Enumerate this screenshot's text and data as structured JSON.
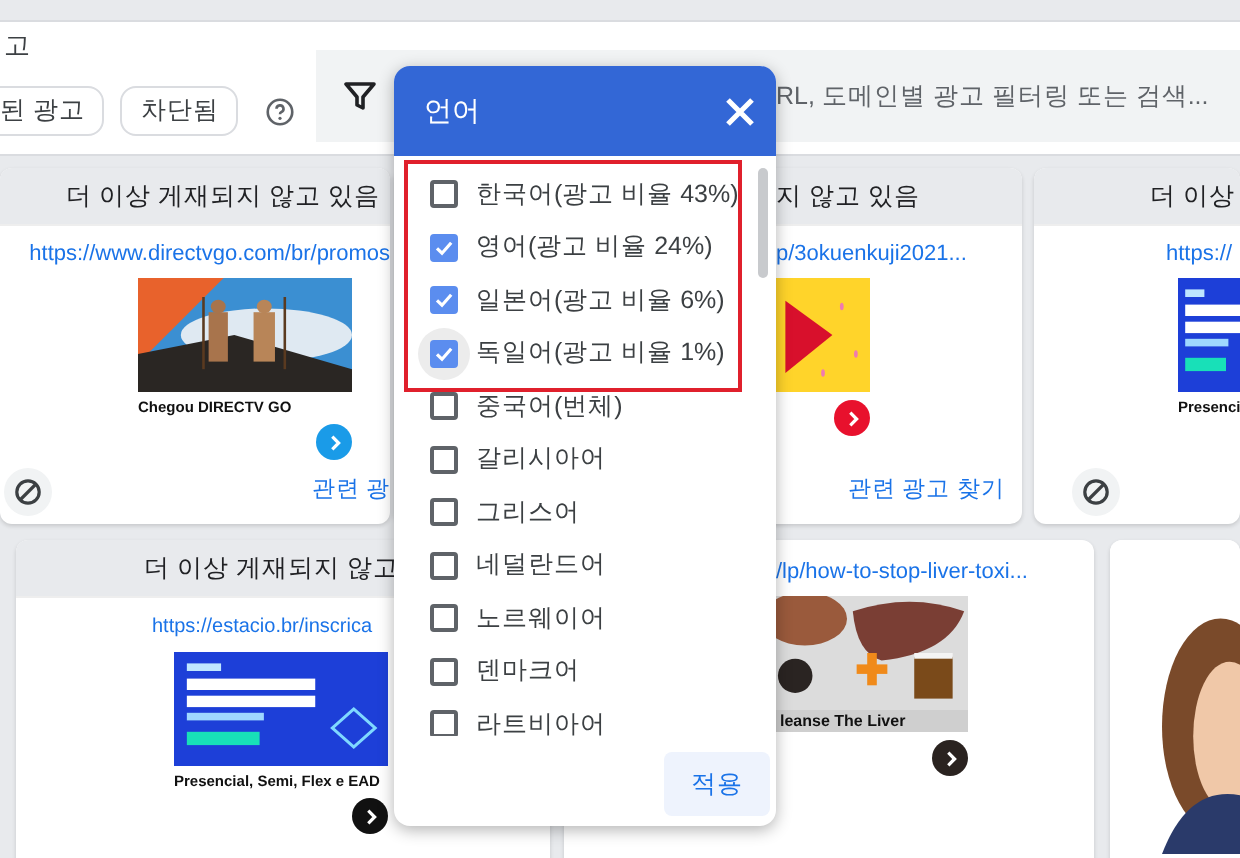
{
  "top": {
    "section_label": "고",
    "filter_buttons": [
      {
        "label": "된 광고"
      },
      {
        "label": "차단됨"
      }
    ],
    "search": {
      "placeholder": "RL, 도메인별 광고 필터링 또는 검색..."
    }
  },
  "cards": [
    {
      "header": "더 이상 게재되지 않고 있음",
      "link": "https://www.directvgo.com/br/promos",
      "ad": {
        "kind": "picture",
        "headline": "Chegou DIRECTV GO",
        "color": "#1a9be8"
      },
      "block_icon": true,
      "related": "관련 광"
    },
    {
      "header": "지 않고 있음",
      "link": "p/3okuenkuji2021...",
      "ad": {
        "kind": "picture",
        "color": "#e8112d"
      },
      "related": "관련 광고 찾기"
    },
    {
      "header": "더 이상",
      "link": "https://",
      "ad": {
        "kind": "picture",
        "headline": "Presenci"
      },
      "block_icon": true
    },
    {
      "header": "더 이상 게재되지 않고",
      "link": "https://estacio.br/inscrica",
      "ad": {
        "kind": "picture",
        "headline": "Presencial, Semi, Flex e EAD",
        "color": "#111111"
      }
    },
    {
      "link": "/lp/how-to-stop-liver-toxi...",
      "ad": {
        "kind": "picture",
        "headline": "leanse The Liver",
        "color": "#2a2320"
      }
    },
    {
      "ad": {
        "kind": "picture"
      }
    }
  ],
  "dialog": {
    "title": "언어",
    "items": [
      {
        "label": "한국어(광고 비율 43%)",
        "checked": false,
        "highlighted": true,
        "focused": false
      },
      {
        "label": "영어(광고 비율 24%)",
        "checked": true,
        "highlighted": true,
        "focused": false
      },
      {
        "label": "일본어(광고 비율 6%)",
        "checked": true,
        "highlighted": true,
        "focused": false
      },
      {
        "label": "독일어(광고 비율 1%)",
        "checked": true,
        "highlighted": true,
        "focused": true
      },
      {
        "label": "중국어(번체)",
        "checked": false,
        "highlighted": false,
        "focused": false
      },
      {
        "label": "갈리시아어",
        "checked": false,
        "highlighted": false,
        "focused": false
      },
      {
        "label": "그리스어",
        "checked": false,
        "highlighted": false,
        "focused": false
      },
      {
        "label": "네덜란드어",
        "checked": false,
        "highlighted": false,
        "focused": false
      },
      {
        "label": "노르웨이어",
        "checked": false,
        "highlighted": false,
        "focused": false
      },
      {
        "label": "덴마크어",
        "checked": false,
        "highlighted": false,
        "focused": false
      },
      {
        "label": "라트비아어",
        "checked": false,
        "highlighted": false,
        "focused": false
      }
    ],
    "apply": "적용"
  }
}
